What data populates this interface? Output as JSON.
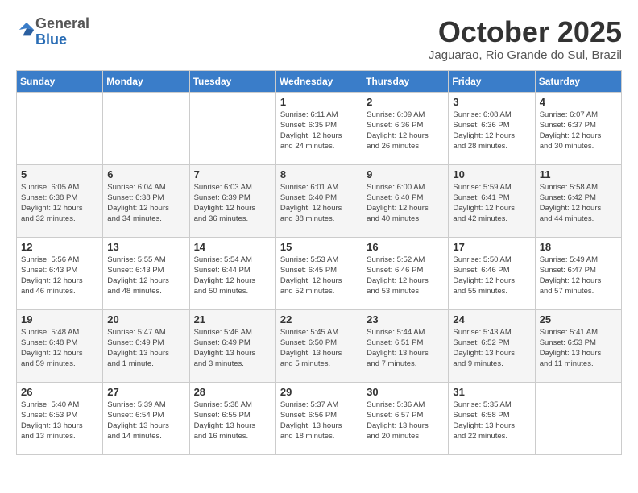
{
  "header": {
    "logo_general": "General",
    "logo_blue": "Blue",
    "month_title": "October 2025",
    "location": "Jaguarao, Rio Grande do Sul, Brazil"
  },
  "weekdays": [
    "Sunday",
    "Monday",
    "Tuesday",
    "Wednesday",
    "Thursday",
    "Friday",
    "Saturday"
  ],
  "weeks": [
    [
      {
        "day": "",
        "info": ""
      },
      {
        "day": "",
        "info": ""
      },
      {
        "day": "",
        "info": ""
      },
      {
        "day": "1",
        "info": "Sunrise: 6:11 AM\nSunset: 6:35 PM\nDaylight: 12 hours\nand 24 minutes."
      },
      {
        "day": "2",
        "info": "Sunrise: 6:09 AM\nSunset: 6:36 PM\nDaylight: 12 hours\nand 26 minutes."
      },
      {
        "day": "3",
        "info": "Sunrise: 6:08 AM\nSunset: 6:36 PM\nDaylight: 12 hours\nand 28 minutes."
      },
      {
        "day": "4",
        "info": "Sunrise: 6:07 AM\nSunset: 6:37 PM\nDaylight: 12 hours\nand 30 minutes."
      }
    ],
    [
      {
        "day": "5",
        "info": "Sunrise: 6:05 AM\nSunset: 6:38 PM\nDaylight: 12 hours\nand 32 minutes."
      },
      {
        "day": "6",
        "info": "Sunrise: 6:04 AM\nSunset: 6:38 PM\nDaylight: 12 hours\nand 34 minutes."
      },
      {
        "day": "7",
        "info": "Sunrise: 6:03 AM\nSunset: 6:39 PM\nDaylight: 12 hours\nand 36 minutes."
      },
      {
        "day": "8",
        "info": "Sunrise: 6:01 AM\nSunset: 6:40 PM\nDaylight: 12 hours\nand 38 minutes."
      },
      {
        "day": "9",
        "info": "Sunrise: 6:00 AM\nSunset: 6:40 PM\nDaylight: 12 hours\nand 40 minutes."
      },
      {
        "day": "10",
        "info": "Sunrise: 5:59 AM\nSunset: 6:41 PM\nDaylight: 12 hours\nand 42 minutes."
      },
      {
        "day": "11",
        "info": "Sunrise: 5:58 AM\nSunset: 6:42 PM\nDaylight: 12 hours\nand 44 minutes."
      }
    ],
    [
      {
        "day": "12",
        "info": "Sunrise: 5:56 AM\nSunset: 6:43 PM\nDaylight: 12 hours\nand 46 minutes."
      },
      {
        "day": "13",
        "info": "Sunrise: 5:55 AM\nSunset: 6:43 PM\nDaylight: 12 hours\nand 48 minutes."
      },
      {
        "day": "14",
        "info": "Sunrise: 5:54 AM\nSunset: 6:44 PM\nDaylight: 12 hours\nand 50 minutes."
      },
      {
        "day": "15",
        "info": "Sunrise: 5:53 AM\nSunset: 6:45 PM\nDaylight: 12 hours\nand 52 minutes."
      },
      {
        "day": "16",
        "info": "Sunrise: 5:52 AM\nSunset: 6:46 PM\nDaylight: 12 hours\nand 53 minutes."
      },
      {
        "day": "17",
        "info": "Sunrise: 5:50 AM\nSunset: 6:46 PM\nDaylight: 12 hours\nand 55 minutes."
      },
      {
        "day": "18",
        "info": "Sunrise: 5:49 AM\nSunset: 6:47 PM\nDaylight: 12 hours\nand 57 minutes."
      }
    ],
    [
      {
        "day": "19",
        "info": "Sunrise: 5:48 AM\nSunset: 6:48 PM\nDaylight: 12 hours\nand 59 minutes."
      },
      {
        "day": "20",
        "info": "Sunrise: 5:47 AM\nSunset: 6:49 PM\nDaylight: 13 hours\nand 1 minute."
      },
      {
        "day": "21",
        "info": "Sunrise: 5:46 AM\nSunset: 6:49 PM\nDaylight: 13 hours\nand 3 minutes."
      },
      {
        "day": "22",
        "info": "Sunrise: 5:45 AM\nSunset: 6:50 PM\nDaylight: 13 hours\nand 5 minutes."
      },
      {
        "day": "23",
        "info": "Sunrise: 5:44 AM\nSunset: 6:51 PM\nDaylight: 13 hours\nand 7 minutes."
      },
      {
        "day": "24",
        "info": "Sunrise: 5:43 AM\nSunset: 6:52 PM\nDaylight: 13 hours\nand 9 minutes."
      },
      {
        "day": "25",
        "info": "Sunrise: 5:41 AM\nSunset: 6:53 PM\nDaylight: 13 hours\nand 11 minutes."
      }
    ],
    [
      {
        "day": "26",
        "info": "Sunrise: 5:40 AM\nSunset: 6:53 PM\nDaylight: 13 hours\nand 13 minutes."
      },
      {
        "day": "27",
        "info": "Sunrise: 5:39 AM\nSunset: 6:54 PM\nDaylight: 13 hours\nand 14 minutes."
      },
      {
        "day": "28",
        "info": "Sunrise: 5:38 AM\nSunset: 6:55 PM\nDaylight: 13 hours\nand 16 minutes."
      },
      {
        "day": "29",
        "info": "Sunrise: 5:37 AM\nSunset: 6:56 PM\nDaylight: 13 hours\nand 18 minutes."
      },
      {
        "day": "30",
        "info": "Sunrise: 5:36 AM\nSunset: 6:57 PM\nDaylight: 13 hours\nand 20 minutes."
      },
      {
        "day": "31",
        "info": "Sunrise: 5:35 AM\nSunset: 6:58 PM\nDaylight: 13 hours\nand 22 minutes."
      },
      {
        "day": "",
        "info": ""
      }
    ]
  ]
}
